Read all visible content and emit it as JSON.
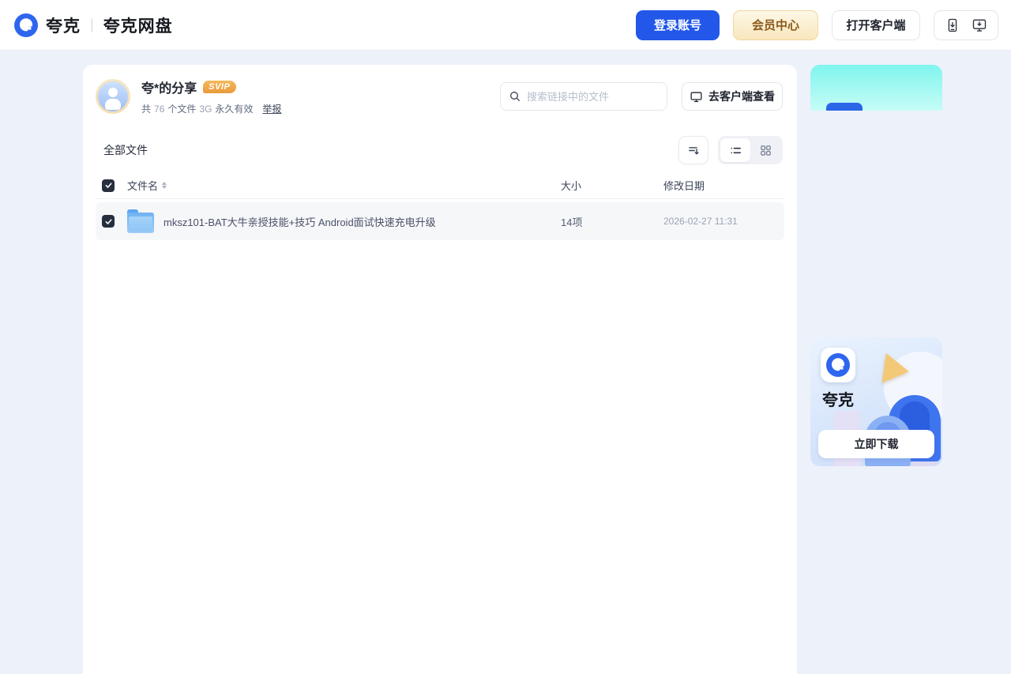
{
  "header": {
    "brand": "夸克",
    "divider": "|",
    "product": "夸克网盘",
    "login_button": "登录账号",
    "vip_button": "会员中心",
    "open_client_button": "打开客户端",
    "icons": [
      "phone-download-icon",
      "desktop-download-icon"
    ]
  },
  "share": {
    "title": "夸*的分享",
    "badge": "SVIP",
    "meta": {
      "prefix": "共",
      "file_count": "76",
      "unit": "个文件",
      "size": "3G",
      "validity": "永久有效",
      "report": "举报"
    },
    "search_placeholder": "搜索链接中的文件",
    "client_view_button": "去客户端查看"
  },
  "files": {
    "section_title": "全部文件",
    "columns": {
      "name": "文件名",
      "size": "大小",
      "modified": "修改日期"
    },
    "rows": [
      {
        "name": "mksz101-BAT大牛亲授技能+技巧 Android面试快速充电升级",
        "type": "folder",
        "checked": true,
        "size": "14项",
        "modified": "2026-02-27 11:31"
      }
    ]
  },
  "sidebar": {
    "download_card": {
      "app_name": "夸克",
      "button": "立即下载"
    }
  },
  "colors": {
    "primary_blue": "#2257ea",
    "vip_text_gold": "#8a5a1c",
    "page_background": "#edf1fa",
    "selected_row": "#f6f7f9",
    "banner_aqua": "#7ff5ee"
  }
}
